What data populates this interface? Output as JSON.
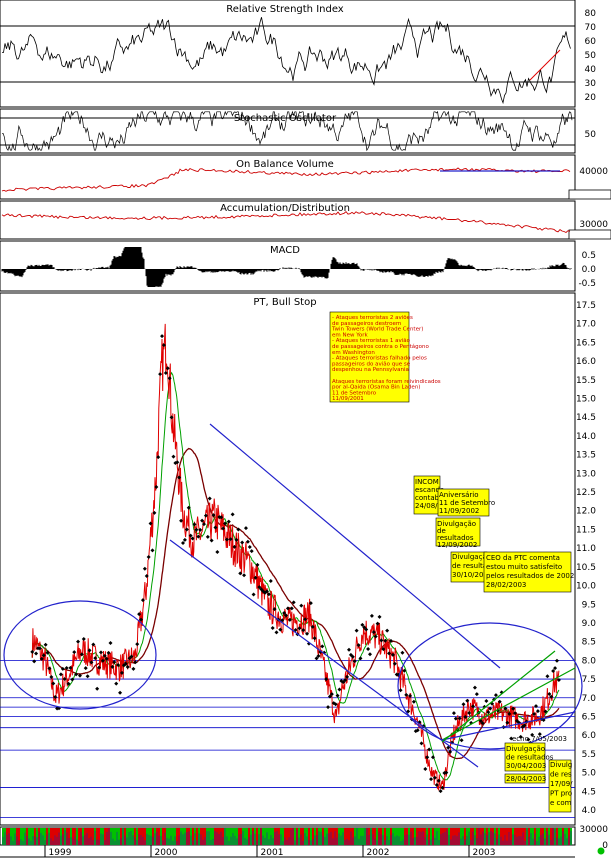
{
  "colors": {
    "price": "#e00000",
    "avg_short": "#00a000",
    "avg_long": "#7a0000",
    "channel": "#2222cc",
    "support": "#0000cc",
    "accent_green": "#00a000",
    "note_bg": "#ffff00",
    "obv_red": "#cc0000",
    "volume_green": "#00c000",
    "volume_red": "#dd0000"
  },
  "chart_data": [
    {
      "type": "line",
      "title": "Relative Strength Index",
      "yticks": [
        "80",
        "70",
        "60",
        "50",
        "40",
        "30",
        "20"
      ],
      "ylim": [
        15,
        85
      ],
      "reference_lines": [
        70,
        30
      ]
    },
    {
      "type": "line",
      "title": "Stochastic Oscillator",
      "yticks": [
        "50"
      ],
      "ylim": [
        0,
        100
      ]
    },
    {
      "type": "line",
      "title": "On Balance Volume",
      "yticks": [
        "40000",
        "30000"
      ]
    },
    {
      "type": "line",
      "title": "Accumulation/Distribution",
      "yticks": [
        "30000"
      ]
    },
    {
      "type": "area",
      "title": "MACD",
      "yticks": [
        "0.5",
        "0.0",
        "-0.5"
      ],
      "ylim": [
        -0.8,
        0.8
      ]
    },
    {
      "type": "line",
      "title": "PT, Bull Stop",
      "yticks": [
        "17.5",
        "17.0",
        "16.5",
        "16.0",
        "15.5",
        "15.0",
        "14.5",
        "14.0",
        "13.5",
        "13.0",
        "12.5",
        "12.0",
        "11.5",
        "11.0",
        "10.5",
        "10.0",
        "9.5",
        "9.0",
        "8.5",
        "8.0",
        "7.5",
        "7.0",
        "6.5",
        "6.0",
        "5.5",
        "5.0",
        "4.5",
        "4.0"
      ],
      "ylim": [
        3.7,
        17.6
      ],
      "x_labels": [
        "1999",
        "2000",
        "2001",
        "2002",
        "2003"
      ],
      "horizontal_lines": [
        8.0,
        7.5,
        7.0,
        6.75,
        6.5,
        6.2,
        5.6,
        4.6,
        3.8
      ],
      "price": [
        [
          1998.9,
          8.5
        ],
        [
          1999.0,
          8.0
        ],
        [
          1999.1,
          7.0
        ],
        [
          1999.2,
          7.5
        ],
        [
          1999.35,
          8.3
        ],
        [
          1999.5,
          8.0
        ],
        [
          1999.7,
          7.8
        ],
        [
          1999.85,
          8.1
        ],
        [
          1999.95,
          9.8
        ],
        [
          2000.05,
          13.0
        ],
        [
          2000.1,
          15.8
        ],
        [
          2000.15,
          16.6
        ],
        [
          2000.2,
          14.5
        ],
        [
          2000.3,
          12.0
        ],
        [
          2000.4,
          11.2
        ],
        [
          2000.6,
          11.8
        ],
        [
          2000.8,
          11.0
        ],
        [
          2000.95,
          10.5
        ],
        [
          2001.1,
          9.5
        ],
        [
          2001.3,
          9.0
        ],
        [
          2001.5,
          9.2
        ],
        [
          2001.7,
          7.0
        ],
        [
          2001.75,
          6.4
        ],
        [
          2001.8,
          7.2
        ],
        [
          2002.0,
          8.8
        ],
        [
          2002.15,
          8.6
        ],
        [
          2002.3,
          8.0
        ],
        [
          2002.5,
          6.5
        ],
        [
          2002.65,
          5.0
        ],
        [
          2002.75,
          4.6
        ],
        [
          2002.85,
          6.0
        ],
        [
          2003.0,
          6.8
        ],
        [
          2003.15,
          6.5
        ],
        [
          2003.3,
          6.6
        ],
        [
          2003.5,
          6.4
        ],
        [
          2003.65,
          6.5
        ],
        [
          2003.75,
          7.0
        ],
        [
          2003.8,
          7.4
        ]
      ]
    },
    {
      "type": "bar",
      "title": "",
      "yticks": [
        "30000",
        "0"
      ]
    }
  ],
  "annotations": {
    "sept11": [
      "- Ataques terroristas 2 aviões",
      "  de passageiros destroem",
      "  Twin Towers (World Trade Center)",
      "  em New York",
      "- Ataques terroristas 1 avião",
      "  de passageiros contra o Pentágono",
      "  em Washington",
      "- Ataques terroristas falhado pelos",
      "  passageiros do avião que se",
      "  despenhou na Pennsylvania",
      "",
      "Ataques terroristas foram reivindicados",
      "por al-Qaida (Osama Bin Laden)",
      "11 de Setembro",
      "11/09/2001"
    ],
    "incom": [
      "INCOM",
      "escanda",
      "contab.",
      "24/08/"
    ],
    "aniversario": [
      "Aniversário",
      "11 de Setembro",
      "11/09/2002"
    ],
    "divulgacao1": [
      "Divulgação",
      "de",
      "resultados",
      "12/09/2002"
    ],
    "divulgacao2": [
      "Divulgação",
      "de resulta",
      "30/10/200"
    ],
    "ceo": [
      "CEO da PTC comenta",
      "estou muito satisfeito",
      "pelos resultados de 2002",
      "28/02/2003"
    ],
    "divulgacao3": [
      "Divulgação",
      "de resultados",
      "30/04/2003"
    ],
    "date_0428": "28/04/2003",
    "divulgacao4": [
      "Divulg",
      "de res",
      "17/09/",
      "PT pro",
      "e com"
    ],
    "echo": "echo 7/05/2003"
  }
}
